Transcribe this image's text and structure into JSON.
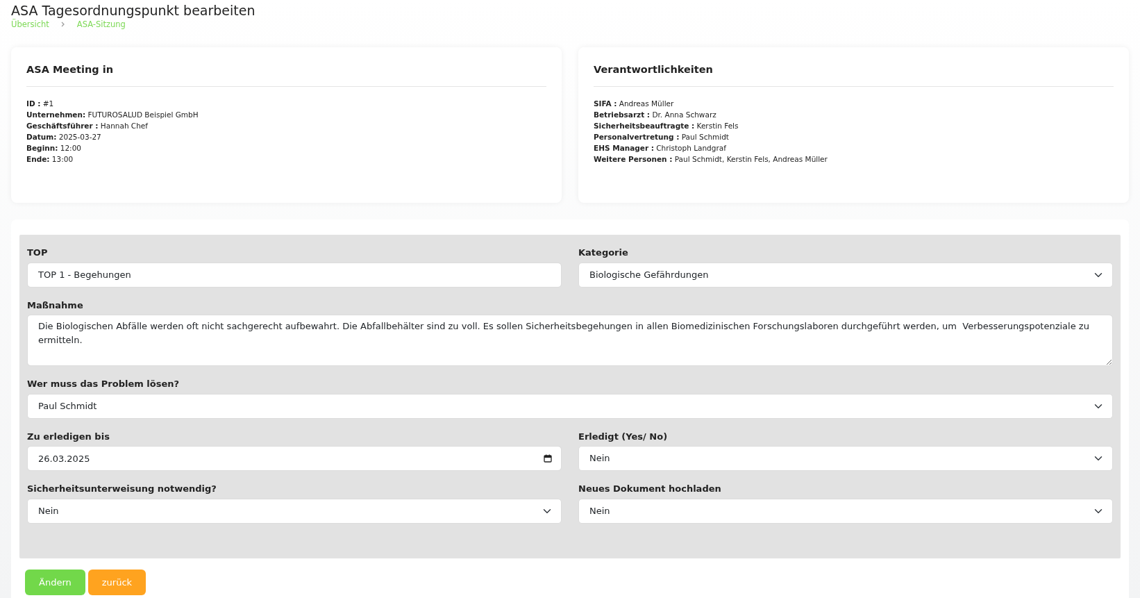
{
  "page": {
    "title": "ASA Tagesordnungspunkt bearbeiten",
    "breadcrumbs": [
      {
        "label": "Übersicht"
      },
      {
        "label": "ASA-Sitzung"
      }
    ]
  },
  "info_cards": [
    {
      "title": "ASA Meeting in",
      "lines": [
        {
          "label": "ID :",
          "value": "#1"
        },
        {
          "label": "Unternehmen:",
          "value": "FUTUROSALUD Beispiel GmbH"
        },
        {
          "label": "Geschäftsführer :",
          "value": "Hannah Chef"
        },
        {
          "label": "Datum:",
          "value": "2025-03-27"
        },
        {
          "label": "Beginn:",
          "value": "12:00"
        },
        {
          "label": "Ende:",
          "value": "13:00"
        }
      ]
    },
    {
      "title": "Verantwortlichkeiten",
      "lines": [
        {
          "label": "SIFA :",
          "value": "Andreas Müller"
        },
        {
          "label": "Betriebsarzt :",
          "value": "Dr. Anna Schwarz"
        },
        {
          "label": "Sicherheitsbeauftragte :",
          "value": "Kerstin Fels"
        },
        {
          "label": "Personalvertretung :",
          "value": "Paul Schmidt"
        },
        {
          "label": "EHS Manager :",
          "value": "Christoph Landgraf"
        },
        {
          "label": "Weitere Personen :",
          "value": "Paul Schmidt, Kerstin Fels, Andreas Müller"
        }
      ]
    }
  ],
  "form": {
    "rows": [
      [
        {
          "label": "TOP",
          "kind": "text",
          "value": "TOP 1 - Begehungen"
        },
        {
          "label": "Kategorie",
          "kind": "select",
          "value": "Biologische Gefährdungen"
        }
      ],
      [
        {
          "label": "Maßnahme",
          "kind": "textarea",
          "value": "Die Biologischen Abfälle werden oft nicht sachgerecht aufbewahrt. Die Abfallbehälter sind zu voll. Es sollen Sicherheitsbegehungen in allen Biomedizinischen Forschungslaboren durchgeführt werden, um  Verbesserungspotenziale zu ermitteln."
        }
      ],
      [
        {
          "label": "Wer muss das Problem lösen?",
          "kind": "select",
          "value": "Paul Schmidt"
        }
      ],
      [
        {
          "label": "Zu erledigen bis",
          "kind": "date",
          "value": "26.03.2025"
        },
        {
          "label": "Erledigt (Yes/ No)",
          "kind": "select",
          "value": "Nein"
        }
      ],
      [
        {
          "label": "Sicherheitsunterweisung notwendig?",
          "kind": "select",
          "value": "Nein"
        },
        {
          "label": "Neues Dokument hochladen",
          "kind": "select",
          "value": "Nein"
        }
      ]
    ],
    "buttons": [
      {
        "label": "Ändern",
        "kind": "primary"
      },
      {
        "label": "zurück",
        "kind": "secondary"
      }
    ]
  }
}
